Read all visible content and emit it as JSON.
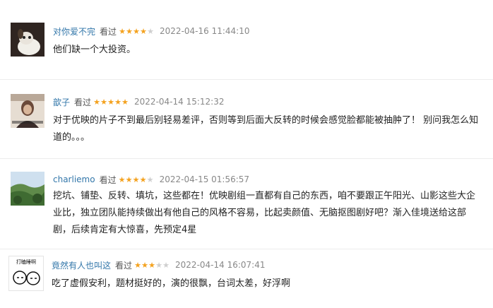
{
  "comments": [
    {
      "user": "对你爱不完",
      "status": "看过",
      "rating": 4,
      "time": "2022-04-16 11:44:10",
      "text": "他们缺一个大投资。"
    },
    {
      "user": "歆子",
      "status": "看过",
      "rating": 5,
      "time": "2022-04-14 15:12:32",
      "text": "对于优映的片子不到最后别轻易差评，否则等到后面大反转的时候会感觉脸都能被抽肿了！ 别问我怎么知道的。。。"
    },
    {
      "user": "charliemo",
      "status": "看过",
      "rating": 4,
      "time": "2022-04-15 01:56:57",
      "text": "挖坑、铺垫、反转、填坑，这些都在！优映剧组一直都有自己的东西，咱不要跟正午阳光、山影这些大企业比，独立团队能持续做出有他自己的风格不容易，比起卖颜值、无脑抠图剧好吧？渐入佳境送给这部剧，后续肯定有大惊喜，先预定4星"
    },
    {
      "user": "竟然有人也叫这",
      "status": "看过",
      "rating": 3,
      "time": "2022-04-14 16:07:41",
      "text": "吃了虚假安利，题材挺好的，演的很飘，台词太差，好浮啊",
      "avatar_text": "打瞌睡啊"
    }
  ],
  "colors": {
    "star_on": "#f4a21f",
    "star_off": "#cfcfcf",
    "username": "#3377aa"
  }
}
